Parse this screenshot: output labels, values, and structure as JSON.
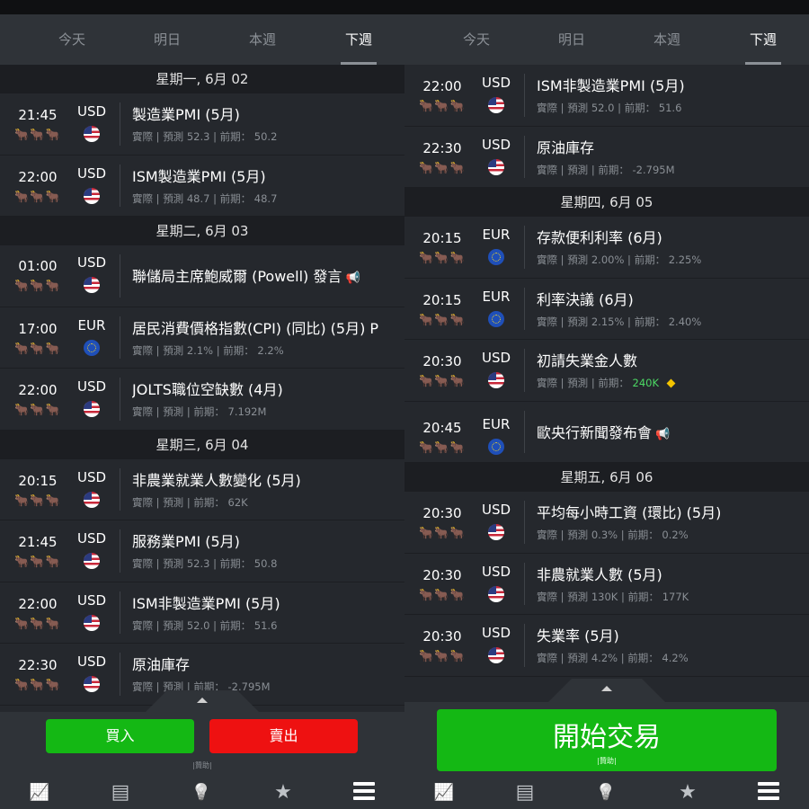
{
  "tabs": [
    {
      "label": "今天"
    },
    {
      "label": "明日"
    },
    {
      "label": "本週"
    },
    {
      "label": "下週"
    }
  ],
  "active_tab_index": 3,
  "labels": {
    "actual": "實際",
    "forecast": "預測",
    "previous": "前期："
  },
  "impact_icon": "bull-head-icon",
  "bulls": "🐂🐂🐂",
  "left": {
    "days": [
      {
        "header": "星期一, 6月 02",
        "events": [
          {
            "time": "21:45",
            "currency": "USD",
            "flag": "us-flag-icon",
            "title": "製造業PMI (5月)",
            "forecast": "52.3",
            "previous": "50.2"
          },
          {
            "time": "22:00",
            "currency": "USD",
            "flag": "us-flag-icon",
            "title": "ISM製造業PMI (5月)",
            "forecast": "48.7",
            "previous": "48.7"
          }
        ]
      },
      {
        "header": "星期二, 6月 03",
        "events": [
          {
            "time": "01:00",
            "currency": "USD",
            "flag": "us-flag-icon",
            "title": "聯儲局主席鮑威爾 (Powell) 發言",
            "speech": true
          },
          {
            "time": "17:00",
            "currency": "EUR",
            "flag": "eu-flag-icon",
            "title": "居民消費價格指數(CPI) (同比) (5月) P",
            "forecast": "2.1%",
            "previous": "2.2%"
          },
          {
            "time": "22:00",
            "currency": "USD",
            "flag": "us-flag-icon",
            "title": "JOLTS職位空缺數 (4月)",
            "forecast": "",
            "previous": "7.192M"
          }
        ]
      },
      {
        "header": "星期三, 6月 04",
        "events": [
          {
            "time": "20:15",
            "currency": "USD",
            "flag": "us-flag-icon",
            "title": "非農業就業人數變化 (5月)",
            "forecast": "",
            "previous": "62K"
          },
          {
            "time": "21:45",
            "currency": "USD",
            "flag": "us-flag-icon",
            "title": "服務業PMI (5月)",
            "forecast": "52.3",
            "previous": "50.8"
          },
          {
            "time": "22:00",
            "currency": "USD",
            "flag": "us-flag-icon",
            "title": "ISM非製造業PMI (5月)",
            "forecast": "52.0",
            "previous": "51.6"
          },
          {
            "time": "22:30",
            "currency": "USD",
            "flag": "us-flag-icon",
            "title": "原油庫存",
            "forecast": "",
            "previous": "-2.795M"
          }
        ]
      }
    ],
    "buy_label": "買入",
    "sell_label": "賣出",
    "sponsor": "|贊助|"
  },
  "right": {
    "days": [
      {
        "header": "",
        "events": [
          {
            "time": "22:00",
            "currency": "USD",
            "flag": "us-flag-icon",
            "title": "ISM非製造業PMI (5月)",
            "forecast": "52.0",
            "previous": "51.6"
          },
          {
            "time": "22:30",
            "currency": "USD",
            "flag": "us-flag-icon",
            "title": "原油庫存",
            "forecast": "",
            "previous": "-2.795M"
          }
        ]
      },
      {
        "header": "星期四, 6月 05",
        "events": [
          {
            "time": "20:15",
            "currency": "EUR",
            "flag": "eu-flag-icon",
            "title": "存款便利利率 (6月)",
            "forecast": "2.00%",
            "previous": "2.25%"
          },
          {
            "time": "20:15",
            "currency": "EUR",
            "flag": "eu-flag-icon",
            "title": "利率決議 (6月)",
            "forecast": "2.15%",
            "previous": "2.40%"
          },
          {
            "time": "20:30",
            "currency": "USD",
            "flag": "us-flag-icon",
            "title": "初請失業金人數",
            "forecast": "",
            "previous": "240K",
            "previous_color": "#4cd964",
            "revised": true
          },
          {
            "time": "20:45",
            "currency": "EUR",
            "flag": "eu-flag-icon",
            "title": "歐央行新聞發布會",
            "speech": true
          }
        ]
      },
      {
        "header": "星期五, 6月 06",
        "events": [
          {
            "time": "20:30",
            "currency": "USD",
            "flag": "us-flag-icon",
            "title": "平均每小時工資 (環比) (5月)",
            "forecast": "0.3%",
            "previous": "0.2%"
          },
          {
            "time": "20:30",
            "currency": "USD",
            "flag": "us-flag-icon",
            "title": "非農就業人數 (5月)",
            "forecast": "130K",
            "previous": "177K"
          },
          {
            "time": "20:30",
            "currency": "USD",
            "flag": "us-flag-icon",
            "title": "失業率 (5月)",
            "forecast": "4.2%",
            "previous": "4.2%"
          }
        ]
      }
    ],
    "start_label": "開始交易",
    "sponsor": "|贊助|"
  },
  "nav_icons": [
    "chart-icon",
    "news-icon",
    "idea-bulb-icon",
    "star-icon",
    "menu-icon"
  ],
  "colors": {
    "buy": "#14b814",
    "sell": "#ee1111",
    "panel": "#25282d",
    "header": "#1c1e22",
    "accent_green": "#4cd964"
  }
}
